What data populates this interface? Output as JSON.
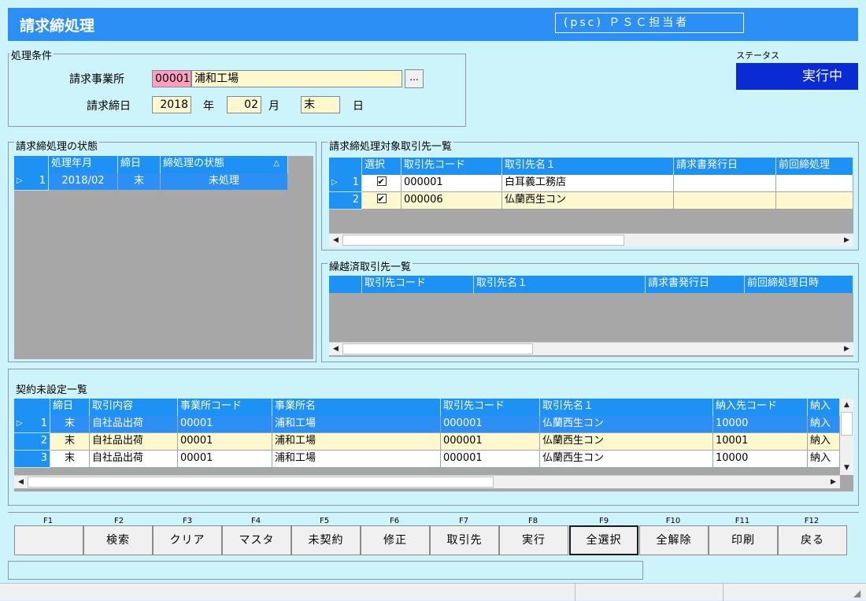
{
  "window_title": "請求締処理",
  "user": "(psc) ＰＳＣ担当者",
  "conditions": {
    "group_label": "処理条件",
    "office_label": "請求事業所",
    "office_code": "00001",
    "office_name": "浦和工場",
    "browse_label": "...",
    "closing_label": "請求締日",
    "year_value": "2018",
    "year_unit": "年",
    "month_value": "02",
    "month_unit": "月",
    "day_value": "末",
    "day_unit": "日"
  },
  "status": {
    "label": "ステータス",
    "value": "実行中"
  },
  "closing_state": {
    "title": "請求締処理の状態",
    "headers": [
      "処理年月",
      "締日",
      "締処理の状態"
    ],
    "sort_indicator": "△",
    "rows": [
      {
        "rownum": "1",
        "ym": "2018/02",
        "day": "末",
        "state": "未処理"
      }
    ]
  },
  "targets": {
    "title": "請求締処理対象取引先一覧",
    "headers": [
      "選択",
      "取引先コード",
      "取引先名１",
      "請求書発行日",
      "前回締処理"
    ],
    "rows": [
      {
        "rownum": "1",
        "code": "000001",
        "name": "白耳義工務店"
      },
      {
        "rownum": "2",
        "code": "000006",
        "name": "仏蘭西生コン"
      }
    ]
  },
  "carried": {
    "title": "繰越済取引先一覧",
    "headers": [
      "取引先コード",
      "取引先名１",
      "請求書発行日",
      "前回締処理日時"
    ]
  },
  "uncontracted": {
    "title": "契約未設定一覧",
    "headers": [
      "締日",
      "取引内容",
      "事業所コード",
      "事業所名",
      "取引先コード",
      "取引先名１",
      "納入先コード",
      "納入"
    ],
    "rows": [
      {
        "rownum": "1",
        "day": "末",
        "content": "自社品出荷",
        "office_code": "00001",
        "office_name": "浦和工場",
        "partner_code": "000001",
        "partner_name": "仏蘭西生コン",
        "dest_code": "10000",
        "dest": "納入"
      },
      {
        "rownum": "2",
        "day": "末",
        "content": "自社品出荷",
        "office_code": "00001",
        "office_name": "浦和工場",
        "partner_code": "000001",
        "partner_name": "仏蘭西生コン",
        "dest_code": "10001",
        "dest": "納入"
      },
      {
        "rownum": "3",
        "day": "末",
        "content": "自社品出荷",
        "office_code": "00001",
        "office_name": "浦和工場",
        "partner_code": "000001",
        "partner_name": "仏蘭西生コン",
        "dest_code": "10000",
        "dest": "納入"
      }
    ]
  },
  "function_keys": [
    {
      "key": "F1",
      "label": ""
    },
    {
      "key": "F2",
      "label": "検索"
    },
    {
      "key": "F3",
      "label": "クリア"
    },
    {
      "key": "F4",
      "label": "マスタ"
    },
    {
      "key": "F5",
      "label": "未契約"
    },
    {
      "key": "F6",
      "label": "修正"
    },
    {
      "key": "F7",
      "label": "取引先"
    },
    {
      "key": "F8",
      "label": "実行"
    },
    {
      "key": "F9",
      "label": "全選択"
    },
    {
      "key": "F10",
      "label": "全解除"
    },
    {
      "key": "F11",
      "label": "印刷"
    },
    {
      "key": "F12",
      "label": "戻る"
    }
  ]
}
